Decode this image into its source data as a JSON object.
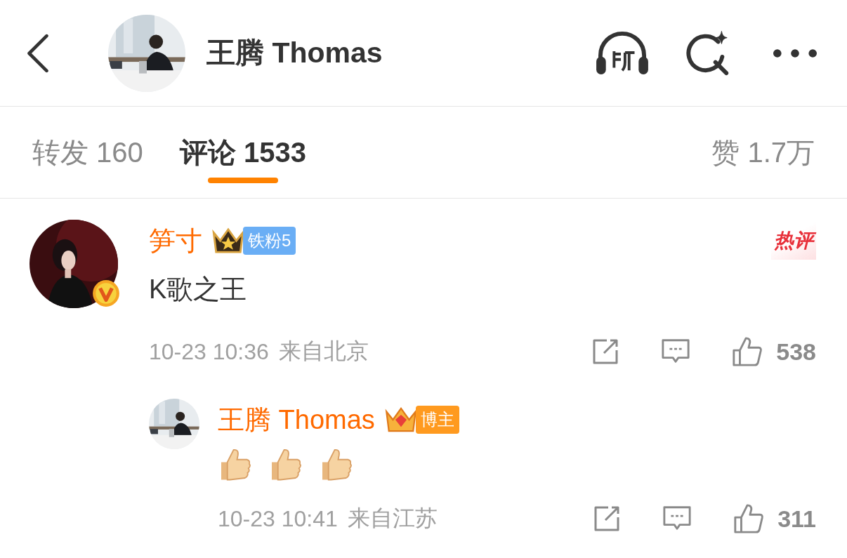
{
  "header": {
    "title": "王腾 Thomas"
  },
  "tabs": [
    {
      "label": "转发",
      "count": "160",
      "selected": false
    },
    {
      "label": "评论",
      "count": "1533",
      "selected": true
    }
  ],
  "likes_tab": {
    "label": "赞",
    "count": "1.7万"
  },
  "comments": [
    {
      "author": "笋寸",
      "verified": true,
      "badge": {
        "kind": "fan",
        "label": "铁粉5"
      },
      "hot_label": "热评",
      "text": "K歌之王",
      "time": "10-23 10:36",
      "location": "来自北京",
      "likes": "538",
      "replies": [
        {
          "author": "王腾 Thomas",
          "badge": {
            "kind": "author",
            "label": "博主"
          },
          "content": [
            {
              "kind": "thumbs_up"
            },
            {
              "kind": "thumbs_up"
            },
            {
              "kind": "thumbs_up"
            }
          ],
          "time": "10-23 10:41",
          "location": "来自江苏",
          "likes": "311"
        }
      ]
    }
  ]
}
